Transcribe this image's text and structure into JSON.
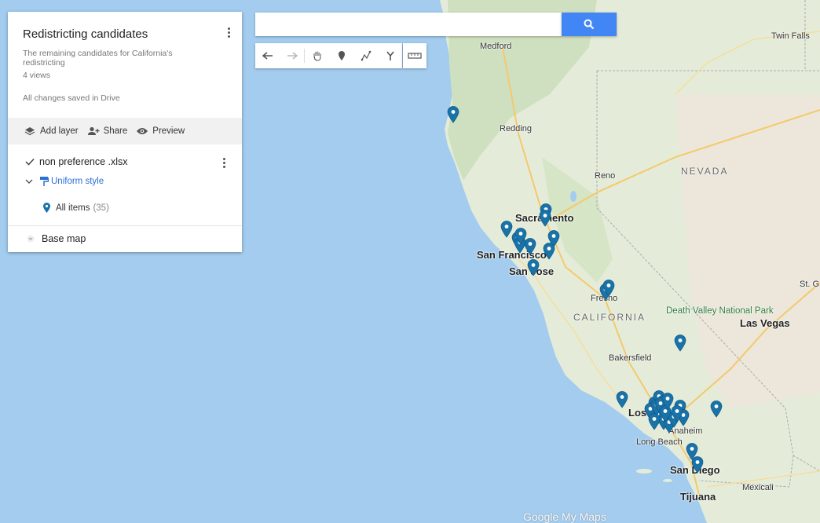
{
  "panel": {
    "title": "Redistricting candidates",
    "description": "The remaining candidates for California's redistricting",
    "views": "4 views",
    "saved": "All changes saved in Drive",
    "actions": {
      "add_layer": "Add layer",
      "share": "Share",
      "preview": "Preview"
    },
    "layer": {
      "name": "non preference .xlsx",
      "style_label": "Uniform style",
      "items_label": "All items",
      "items_count": "(35)"
    },
    "base_map": "Base map"
  },
  "search": {
    "value": "",
    "placeholder": ""
  },
  "map_labels": {
    "twin_falls": "Twin Falls",
    "medford": "Medford",
    "redding": "Redding",
    "reno": "Reno",
    "nevada": "NEVADA",
    "sacramento": "Sacramento",
    "san_francisco": "San Francisco",
    "san_jose": "San Jose",
    "fresno": "Fresno",
    "california": "CALIFORNIA",
    "death_valley": "Death Valley National Park",
    "las_vegas": "Las Vegas",
    "st_george": "St. G",
    "bakersfield": "Bakersfield",
    "los_angeles": "Los",
    "anaheim": "Anaheim",
    "long_beach": "Long Beach",
    "san_diego": "San Diego",
    "tijuana": "Tijuana",
    "mexicali": "Mexicali"
  },
  "attribution": "Google My Maps",
  "colors": {
    "pin": "#1a73a8",
    "search_button": "#4285f4",
    "water": "#a3ccef",
    "land": "#e6eede"
  }
}
